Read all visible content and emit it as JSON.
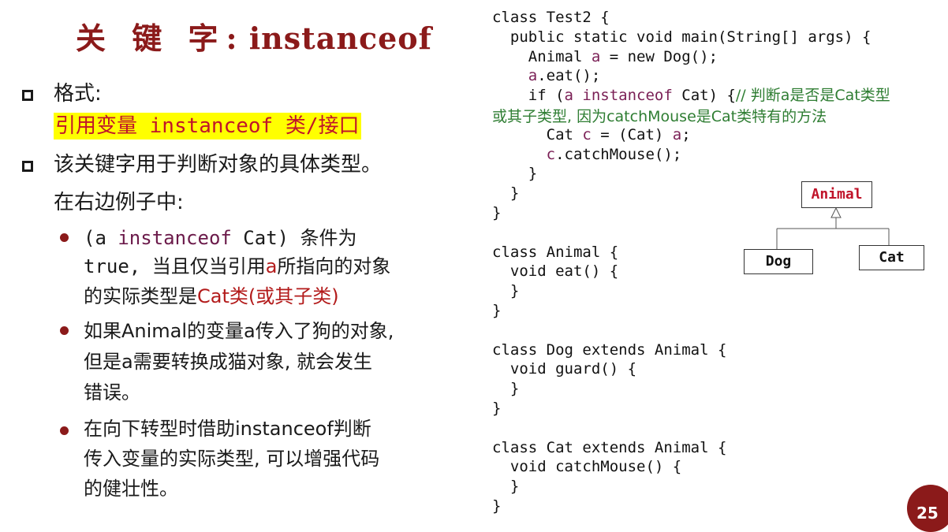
{
  "title": {
    "cjk": "关 键 字",
    "colon_kw": ": instanceof"
  },
  "left": {
    "format_label": "格式:",
    "format_value": "引用变量 instanceof 类/接口",
    "usage_line1": "该关键字用于判断对象的具体类型。",
    "usage_line2": "在右边例子中:",
    "point1": {
      "line1_a": "(a ",
      "line1_kw": "instanceof",
      "line1_b": " Cat) 条件为",
      "line2_a": "true, 当且仅当引用",
      "line2_a_var": "a",
      "line2_b": "所指向的对象",
      "line3_a": "的实际类型是",
      "line3_red": "Cat类(或其子类)"
    },
    "point2": {
      "line1": "如果Animal的变量a传入了狗的对象,",
      "line2": "但是a需要转换成猫对象, 就会发生",
      "line3": "错误。"
    },
    "point3": {
      "line1": "在向下转型时借助instanceof判断",
      "line2": "传入变量的实际类型, 可以增强代码",
      "line3": "的健壮性。"
    }
  },
  "code": {
    "l01": "class Test2 {",
    "l02": "  public static void main(String[] args) {",
    "l03a": "    Animal ",
    "l03v": "a",
    "l03b": " = new Dog();",
    "l04a": "    ",
    "l04v": "a",
    "l04b": ".eat();",
    "l05a": "    if (",
    "l05v": "a",
    "l05k": " instanceof",
    "l05b": " Cat) {",
    "l05c": "// 判断a是否是Cat类型",
    "l05c2": "或其子类型, 因为catchMouse是Cat类特有的方法",
    "l06a": "      Cat ",
    "l06v": "c",
    "l06b": " = (Cat) ",
    "l06v2": "a",
    "l06c": ";",
    "l07a": "      ",
    "l07v": "c",
    "l07b": ".catchMouse();",
    "l08": "    }",
    "l09": "  }",
    "l10": "}",
    "l12": "class Animal {",
    "l13": "  void eat() {",
    "l14": "  }",
    "l15": "}",
    "l17": "class Dog extends Animal {",
    "l18": "  void guard() {",
    "l19": "  }",
    "l20": "}",
    "l22": "class Cat extends Animal {",
    "l23": "  void catchMouse() {",
    "l24": "  }",
    "l25": "}"
  },
  "diagram": {
    "parent": "Animal",
    "child1": "Dog",
    "child2": "Cat"
  },
  "page_number": "25"
}
